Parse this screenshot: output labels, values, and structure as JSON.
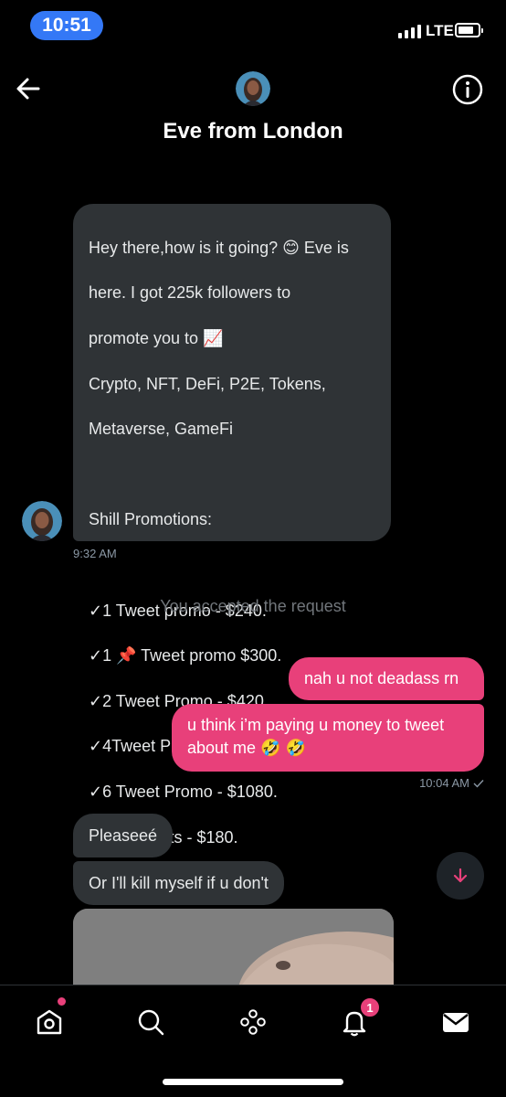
{
  "status_bar": {
    "time": "10:51",
    "network": "LTE"
  },
  "header": {
    "title": "Eve from London",
    "avatar_icon": "profile-avatar",
    "back_icon": "arrow-left-icon",
    "info_icon": "info-icon"
  },
  "messages": {
    "first": {
      "lines": [
        "Hey there,how is it going? 😊 Eve is",
        "here.  I got 225k followers to",
        "promote you to 📈",
        "Crypto, NFT, DeFi, P2E, Tokens,",
        "Metaverse, GameFi",
        "",
        "Shill Promotions:",
        "",
        "✓1 Tweet promo - $240.",
        "✓1 📌 Tweet promo  $300.",
        "✓2 Tweet Promo - $420.",
        "✓4Tweet Promo - $790.",
        "✓6 Tweet Promo - $1080.",
        "🐌 Retweets - $180."
      ],
      "time": "9:32 AM"
    },
    "system_note": "You accepted the request",
    "outgoing_1": "nah u not deadass rn",
    "outgoing_2_line1": "u think i’m paying u money to tweet",
    "outgoing_2_line2": "about me 🤣 🤣",
    "outgoing_time": "10:04 AM",
    "incoming_2": "Pleaseeé",
    "incoming_3": "Or I'll kill myself if u don't"
  },
  "nav": {
    "items": [
      "home-icon",
      "search-icon",
      "spaces-icon",
      "notifications-icon",
      "messages-icon"
    ],
    "notifications_badge": "1"
  },
  "colors": {
    "accent": "#e8407a",
    "incoming_bubble": "#2f3336",
    "status_pill": "#3478f6"
  }
}
